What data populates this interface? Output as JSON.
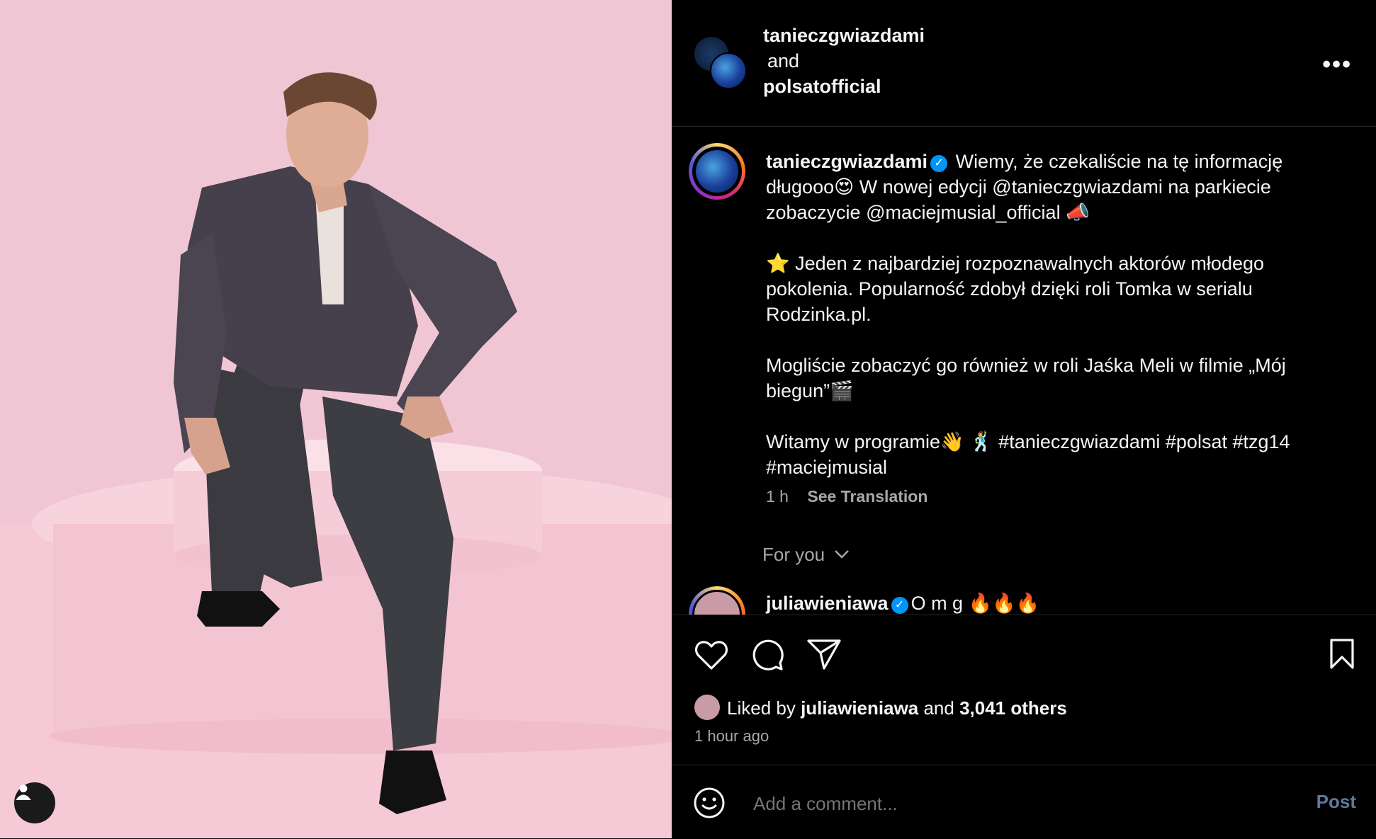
{
  "header": {
    "user1": "tanieczgwiazdami",
    "joiner": "and",
    "user2": "polsatofficial",
    "more_icon": "more-horizontal-icon"
  },
  "caption": {
    "username": "tanieczgwiazdami",
    "line1": " Wiemy, że czekaliście na tę informację długooo😍 W nowej edycji @tanieczgwiazdami na parkiecie zobaczycie @maciejmusial_official 📣",
    "para2": "⭐️ Jeden z najbardziej rozpoznawalnych aktorów młodego pokolenia. Popularność zdobył dzięki roli Tomka w serialu Rodzinka.pl.",
    "para3": "Mogliście zobaczyć go również w roli Jaśka Meli w filmie „Mój biegun”🎬",
    "para4": "Witamy w programie👋 🕺 #tanieczgwiazdami #polsat #tzg14 #maciejmusial",
    "time": "1 h",
    "see_translation": "See Translation"
  },
  "for_you": "For you",
  "comment": {
    "username": "juliawieniawa",
    "text": "O m g 🔥🔥🔥"
  },
  "likes": {
    "prefix": "Liked by ",
    "user": "juliawieniawa",
    "middle": " and ",
    "others": "3,041 others",
    "time_ago": "1 hour ago"
  },
  "comment_box": {
    "placeholder": "Add a comment...",
    "post_label": "Post"
  },
  "colors": {
    "background": "#000000",
    "photo_bg": "#efc4d3",
    "verified": "#0095f6",
    "post_disabled": "#5e7a99"
  }
}
